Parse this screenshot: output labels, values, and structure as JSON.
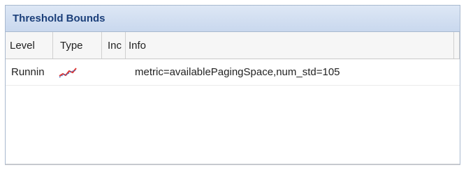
{
  "panel": {
    "title": "Threshold Bounds"
  },
  "table": {
    "columns": [
      "Level",
      "Type",
      "Inc",
      "Info"
    ],
    "rows": [
      {
        "level": "Runnin",
        "type_icon": "trend-line-icon",
        "inc": "",
        "info": "metric=availablePagingSpace,num_std=105"
      }
    ]
  },
  "colors": {
    "header_title": "#1b3f7a",
    "header_bg": "#cfdcf0",
    "border": "#a9b9cf",
    "icon_red": "#e0342f",
    "icon_blue": "#2f6fd0"
  }
}
